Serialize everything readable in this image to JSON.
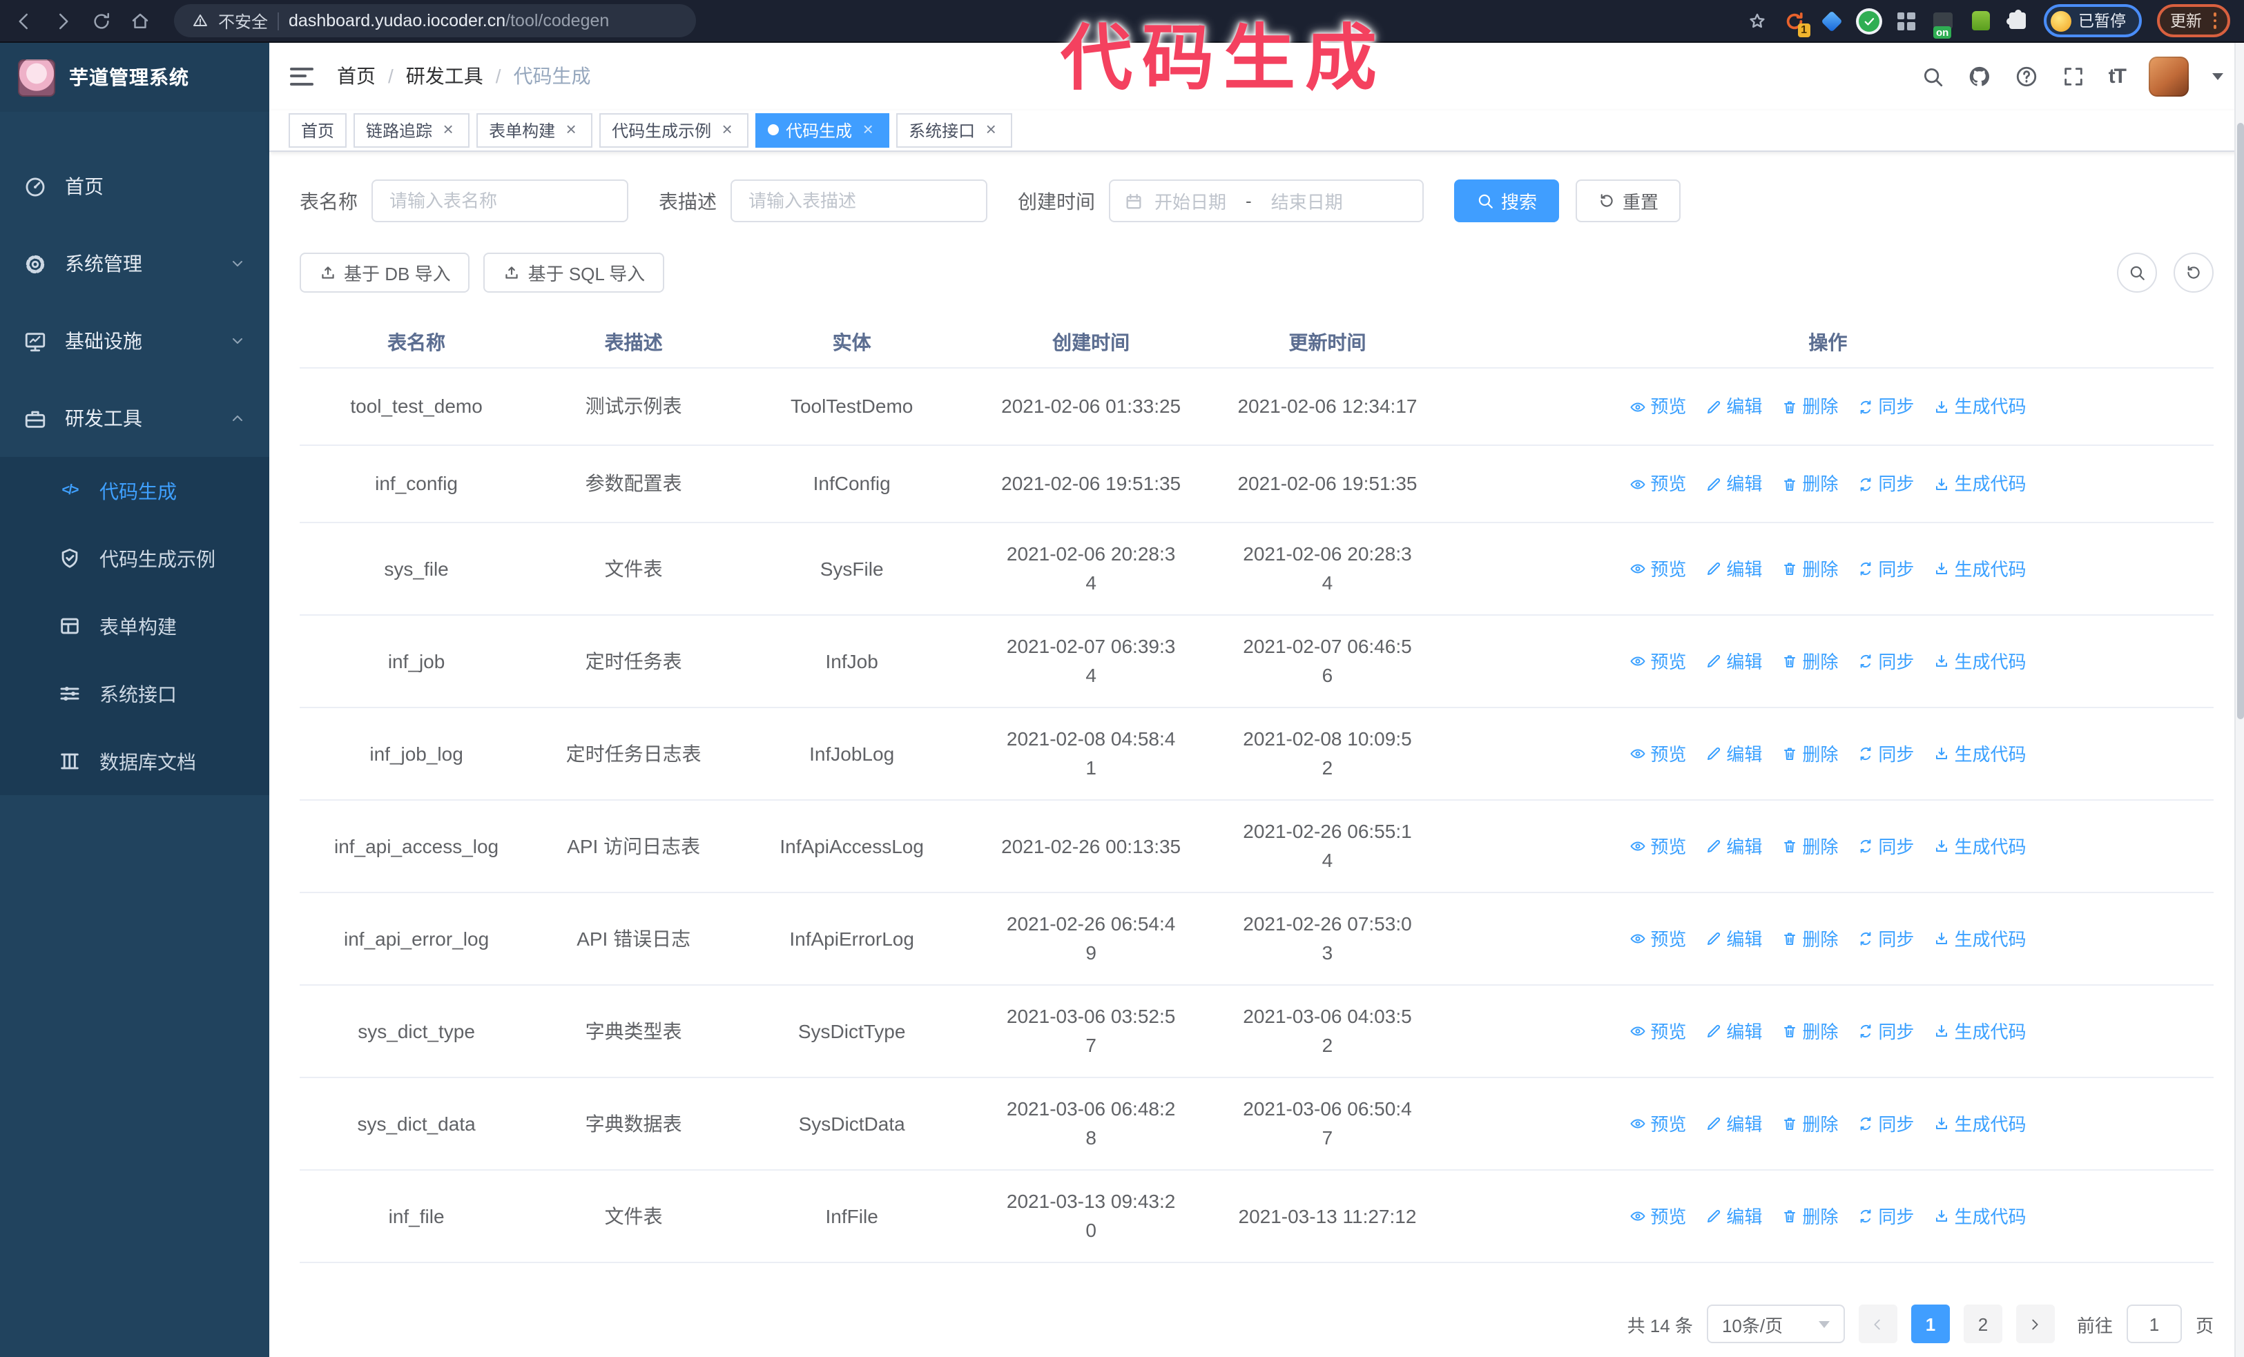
{
  "browser": {
    "security_label": "不安全",
    "url_host": "dashboard.yudao.iocoder.cn",
    "url_path": "/tool/codegen",
    "extensions": {
      "orange_badge": "1",
      "proxy_badge": "on"
    },
    "paused_pill_label": "已暂停",
    "update_pill_label": "更新"
  },
  "annotation": {
    "text": "代码生成",
    "color": "#f4415f"
  },
  "sidebar": {
    "title": "芋道管理系统",
    "items": [
      {
        "label": "首页",
        "icon": "dashboard-icon",
        "expandable": false,
        "expanded": false
      },
      {
        "label": "系统管理",
        "icon": "gear-icon",
        "expandable": true,
        "expanded": false
      },
      {
        "label": "基础设施",
        "icon": "monitor-icon",
        "expandable": true,
        "expanded": false
      },
      {
        "label": "研发工具",
        "icon": "toolbox-icon",
        "expandable": true,
        "expanded": true
      }
    ],
    "subitems": [
      {
        "label": "代码生成",
        "icon": "code-icon",
        "active": true
      },
      {
        "label": "代码生成示例",
        "icon": "shield-check-icon",
        "active": false
      },
      {
        "label": "表单构建",
        "icon": "form-grid-icon",
        "active": false
      },
      {
        "label": "系统接口",
        "icon": "sliders-icon",
        "active": false
      },
      {
        "label": "数据库文档",
        "icon": "database-icon",
        "active": false
      }
    ]
  },
  "navbar": {
    "breadcrumb": [
      "首页",
      "研发工具",
      "代码生成"
    ],
    "breadcrumb_separator": "/",
    "font_size_icon_text": "tT"
  },
  "tabs": [
    {
      "label": "首页",
      "closable": false,
      "active": false
    },
    {
      "label": "链路追踪",
      "closable": true,
      "active": false
    },
    {
      "label": "表单构建",
      "closable": true,
      "active": false
    },
    {
      "label": "代码生成示例",
      "closable": true,
      "active": false
    },
    {
      "label": "代码生成",
      "closable": true,
      "active": true
    },
    {
      "label": "系统接口",
      "closable": true,
      "active": false
    }
  ],
  "search_form": {
    "table_name_label": "表名称",
    "table_name_placeholder": "请输入表名称",
    "table_desc_label": "表描述",
    "table_desc_placeholder": "请输入表描述",
    "create_time_label": "创建时间",
    "start_placeholder": "开始日期",
    "range_separator": "-",
    "end_placeholder": "结束日期",
    "search_label": "搜索",
    "reset_label": "重置"
  },
  "toolbar": {
    "import_db_label": "基于 DB 导入",
    "import_sql_label": "基于 SQL 导入"
  },
  "table": {
    "columns": [
      "表名称",
      "表描述",
      "实体",
      "创建时间",
      "更新时间",
      "操作"
    ],
    "actions": [
      "预览",
      "编辑",
      "删除",
      "同步",
      "生成代码"
    ],
    "rows": [
      {
        "name": "tool_test_demo",
        "desc": "测试示例表",
        "entity": "ToolTestDemo",
        "created": "2021-02-06 01:33:25",
        "updated": "2021-02-06 12:34:17",
        "cw": false,
        "uw": false
      },
      {
        "name": "inf_config",
        "desc": "参数配置表",
        "entity": "InfConfig",
        "created": "2021-02-06 19:51:35",
        "updated": "2021-02-06 19:51:35",
        "cw": false,
        "uw": false
      },
      {
        "name": "sys_file",
        "desc": "文件表",
        "entity": "SysFile",
        "created": "2021-02-06 20:28:34",
        "updated": "2021-02-06 20:28:34",
        "cw": true,
        "uw": true
      },
      {
        "name": "inf_job",
        "desc": "定时任务表",
        "entity": "InfJob",
        "created": "2021-02-07 06:39:34",
        "updated": "2021-02-07 06:46:56",
        "cw": true,
        "uw": true
      },
      {
        "name": "inf_job_log",
        "desc": "定时任务日志表",
        "entity": "InfJobLog",
        "created": "2021-02-08 04:58:41",
        "updated": "2021-02-08 10:09:52",
        "cw": true,
        "uw": true
      },
      {
        "name": "inf_api_access_log",
        "desc": "API 访问日志表",
        "entity": "InfApiAccessLog",
        "created": "2021-02-26 00:13:35",
        "updated": "2021-02-26 06:55:14",
        "cw": false,
        "uw": true
      },
      {
        "name": "inf_api_error_log",
        "desc": "API 错误日志",
        "entity": "InfApiErrorLog",
        "created": "2021-02-26 06:54:49",
        "updated": "2021-02-26 07:53:03",
        "cw": true,
        "uw": true
      },
      {
        "name": "sys_dict_type",
        "desc": "字典类型表",
        "entity": "SysDictType",
        "created": "2021-03-06 03:52:57",
        "updated": "2021-03-06 04:03:52",
        "cw": true,
        "uw": true
      },
      {
        "name": "sys_dict_data",
        "desc": "字典数据表",
        "entity": "SysDictData",
        "created": "2021-03-06 06:48:28",
        "updated": "2021-03-06 06:50:47",
        "cw": true,
        "uw": true
      },
      {
        "name": "inf_file",
        "desc": "文件表",
        "entity": "InfFile",
        "created": "2021-03-13 09:43:20",
        "updated": "2021-03-13 11:27:12",
        "cw": true,
        "uw": false
      }
    ]
  },
  "pagination": {
    "total_label": "共 14 条",
    "page_size_value": "10条/页",
    "pages": [
      "1",
      "2"
    ],
    "active_page": "1",
    "goto_label": "前往",
    "goto_value": "1",
    "goto_suffix": "页"
  }
}
